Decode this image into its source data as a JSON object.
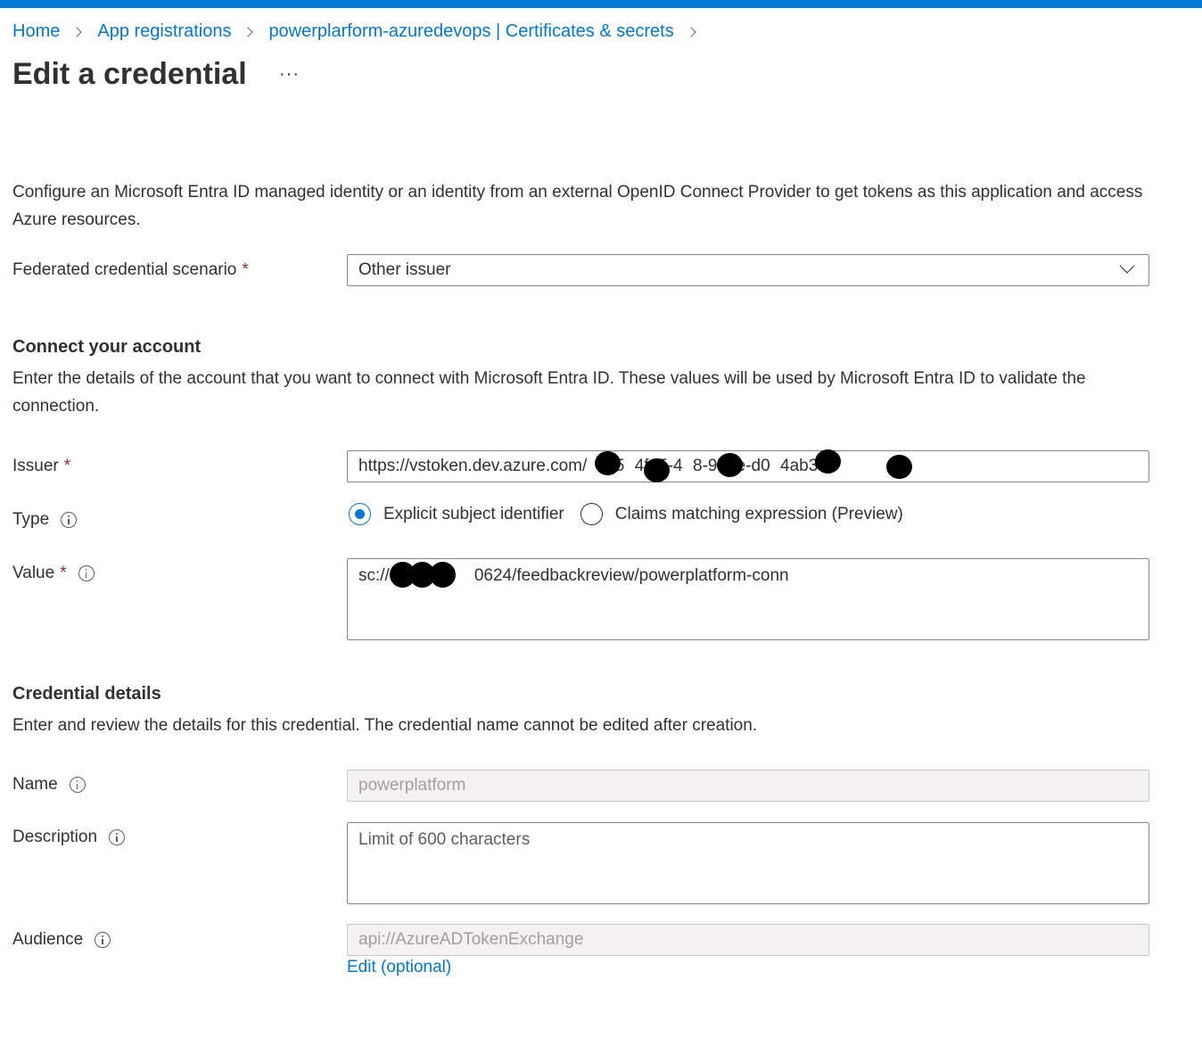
{
  "breadcrumb": {
    "home": "Home",
    "app_registrations": "App registrations",
    "current": "powerplarform-azuredevops | Certificates & secrets"
  },
  "page": {
    "title": "Edit a credential",
    "more": "···"
  },
  "intro": "Configure an Microsoft Entra ID managed identity or an identity from an external OpenID Connect Provider to get tokens as this application and access Azure resources.",
  "scenario": {
    "label": "Federated credential scenario",
    "required": "*",
    "value": "Other issuer"
  },
  "connect": {
    "heading": "Connect your account",
    "description": "Enter the details of the account that you want to connect with Microsoft Entra ID. These values will be used by Microsoft Entra ID to validate the connection."
  },
  "issuer": {
    "label": "Issuer",
    "required": "*",
    "value": "https://vstoken.dev.azure.com/   dc5   4f45-4   8-972e-d0   4ab3e"
  },
  "type": {
    "label": "Type",
    "options": [
      "Explicit subject identifier",
      "Claims matching expression (Preview)"
    ],
    "selected": "Explicit subject identifier"
  },
  "value_field": {
    "label": "Value",
    "required": "*",
    "value": "sc://     0624/feedbackreview/powerplatform-conn"
  },
  "details": {
    "heading": "Credential details",
    "description": "Enter and review the details for this credential. The credential name cannot be edited after creation."
  },
  "name": {
    "label": "Name",
    "value": "powerplatform"
  },
  "description_field": {
    "label": "Description",
    "placeholder": "Limit of 600 characters"
  },
  "audience": {
    "label": "Audience",
    "value": "api://AzureADTokenExchange",
    "edit_link": "Edit (optional)"
  },
  "colors": {
    "accent": "#0078d4",
    "required": "#a4262c",
    "text": "#323130"
  }
}
